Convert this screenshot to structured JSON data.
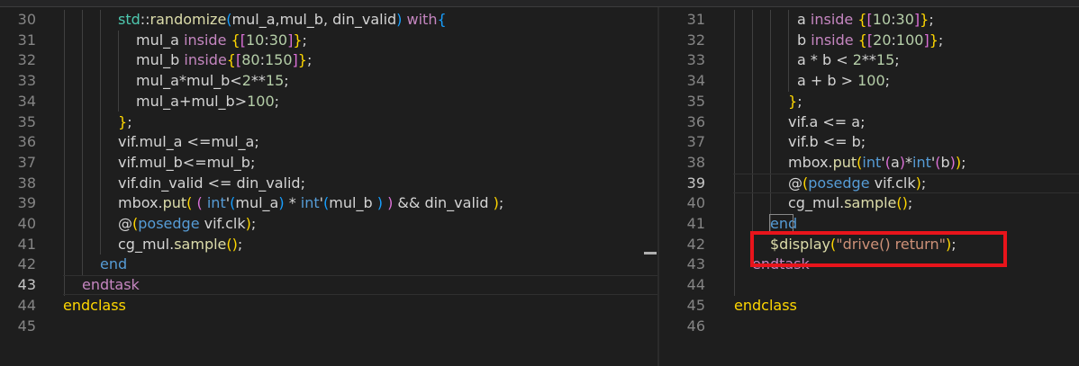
{
  "left_pane": {
    "lines": [
      {
        "n": "30",
        "tokens": [
          [
            "std",
            "ns"
          ],
          [
            "::",
            "var"
          ],
          [
            "randomize",
            "fn"
          ],
          [
            "(",
            "br3"
          ],
          [
            "mul_a,mul_b, din_valid",
            "var"
          ],
          [
            ")",
            "br3"
          ],
          [
            " ",
            "var"
          ],
          [
            "with",
            "ctl"
          ],
          [
            "{",
            "br3"
          ]
        ]
      },
      {
        "n": "31",
        "tokens": [
          [
            "mul_a ",
            "var"
          ],
          [
            "inside",
            "ctl"
          ],
          [
            " ",
            "var"
          ],
          [
            "{",
            "br1"
          ],
          [
            "[",
            "br2"
          ],
          [
            "10",
            "num"
          ],
          [
            ":",
            "var"
          ],
          [
            "30",
            "num"
          ],
          [
            "]",
            "br2"
          ],
          [
            "}",
            "br1"
          ],
          [
            ";",
            "var"
          ]
        ]
      },
      {
        "n": "32",
        "tokens": [
          [
            "mul_b ",
            "var"
          ],
          [
            "inside",
            "ctl"
          ],
          [
            "{",
            "br1"
          ],
          [
            "[",
            "br2"
          ],
          [
            "80",
            "num"
          ],
          [
            ":",
            "var"
          ],
          [
            "150",
            "num"
          ],
          [
            "]",
            "br2"
          ],
          [
            "}",
            "br1"
          ],
          [
            ";",
            "var"
          ]
        ]
      },
      {
        "n": "33",
        "tokens": [
          [
            "mul_a*mul_b<",
            "var"
          ],
          [
            "2",
            "num"
          ],
          [
            "**",
            "var"
          ],
          [
            "15",
            "num"
          ],
          [
            ";",
            "var"
          ]
        ]
      },
      {
        "n": "34",
        "tokens": [
          [
            "mul_a+mul_b>",
            "var"
          ],
          [
            "100",
            "num"
          ],
          [
            ";",
            "var"
          ]
        ]
      },
      {
        "n": "35",
        "tokens": [
          [
            "}",
            "br1"
          ],
          [
            ";",
            "var"
          ]
        ]
      },
      {
        "n": "36",
        "tokens": [
          [
            "vif.mul_a <=mul_a;",
            "var"
          ]
        ]
      },
      {
        "n": "37",
        "tokens": [
          [
            "vif.mul_b<=mul_b;",
            "var"
          ]
        ]
      },
      {
        "n": "38",
        "tokens": [
          [
            "vif.din_valid <= din_valid;",
            "var"
          ]
        ]
      },
      {
        "n": "39",
        "tokens": [
          [
            "mbox.",
            "var"
          ],
          [
            "put",
            "fn"
          ],
          [
            "(",
            "br1"
          ],
          [
            " ",
            "var"
          ],
          [
            "(",
            "br2"
          ],
          [
            " ",
            "var"
          ],
          [
            "int",
            "kw"
          ],
          [
            "'",
            "var"
          ],
          [
            "(",
            "br3"
          ],
          [
            "mul_a",
            "var"
          ],
          [
            ")",
            "br3"
          ],
          [
            " * ",
            "var"
          ],
          [
            "int",
            "kw"
          ],
          [
            "'",
            "var"
          ],
          [
            "(",
            "br3"
          ],
          [
            "mul_b ",
            "var"
          ],
          [
            ")",
            "br3"
          ],
          [
            " ",
            "var"
          ],
          [
            ")",
            "br2"
          ],
          [
            " && din_valid ",
            "var"
          ],
          [
            ")",
            "br1"
          ],
          [
            ";",
            "var"
          ]
        ]
      },
      {
        "n": "40",
        "tokens": [
          [
            "@",
            "var"
          ],
          [
            "(",
            "br1"
          ],
          [
            "posedge",
            "kw"
          ],
          [
            " vif.clk",
            "var"
          ],
          [
            ")",
            "br1"
          ],
          [
            ";",
            "var"
          ]
        ]
      },
      {
        "n": "41",
        "tokens": [
          [
            "cg_mul.",
            "var"
          ],
          [
            "sample",
            "fn"
          ],
          [
            "()",
            "br1"
          ],
          [
            ";",
            "var"
          ]
        ]
      },
      {
        "n": "42",
        "tokens": [
          [
            "end",
            "kw"
          ]
        ]
      },
      {
        "n": "43",
        "tokens": [
          [
            "endtask",
            "ctl"
          ]
        ]
      },
      {
        "n": "44",
        "tokens": [
          [
            "endclass",
            "br1"
          ]
        ]
      },
      {
        "n": "45",
        "tokens": []
      }
    ]
  },
  "right_pane": {
    "lines": [
      {
        "n": "31",
        "tokens": [
          [
            "a ",
            "var"
          ],
          [
            "inside",
            "ctl"
          ],
          [
            " ",
            "var"
          ],
          [
            "{",
            "br1"
          ],
          [
            "[",
            "br2"
          ],
          [
            "10",
            "num"
          ],
          [
            ":",
            "var"
          ],
          [
            "30",
            "num"
          ],
          [
            "]",
            "br2"
          ],
          [
            "}",
            "br1"
          ],
          [
            ";",
            "var"
          ]
        ]
      },
      {
        "n": "32",
        "tokens": [
          [
            "b ",
            "var"
          ],
          [
            "inside",
            "ctl"
          ],
          [
            " ",
            "var"
          ],
          [
            "{",
            "br1"
          ],
          [
            "[",
            "br2"
          ],
          [
            "20",
            "num"
          ],
          [
            ":",
            "var"
          ],
          [
            "100",
            "num"
          ],
          [
            "]",
            "br2"
          ],
          [
            "}",
            "br1"
          ],
          [
            ";",
            "var"
          ]
        ]
      },
      {
        "n": "33",
        "tokens": [
          [
            "a * b < ",
            "var"
          ],
          [
            "2",
            "num"
          ],
          [
            "**",
            "var"
          ],
          [
            "15",
            "num"
          ],
          [
            ";",
            "var"
          ]
        ]
      },
      {
        "n": "34",
        "tokens": [
          [
            "a + b > ",
            "var"
          ],
          [
            "100",
            "num"
          ],
          [
            ";",
            "var"
          ]
        ]
      },
      {
        "n": "35",
        "tokens": [
          [
            "}",
            "br1"
          ],
          [
            ";",
            "var"
          ]
        ]
      },
      {
        "n": "36",
        "tokens": [
          [
            "vif.a <= a;",
            "var"
          ]
        ]
      },
      {
        "n": "37",
        "tokens": [
          [
            "vif.b <= b;",
            "var"
          ]
        ]
      },
      {
        "n": "38",
        "tokens": [
          [
            "mbox.",
            "var"
          ],
          [
            "put",
            "fn"
          ],
          [
            "(",
            "br1"
          ],
          [
            "int",
            "kw"
          ],
          [
            "'",
            "var"
          ],
          [
            "(",
            "br2"
          ],
          [
            "a",
            "var"
          ],
          [
            ")",
            "br2"
          ],
          [
            "*",
            "var"
          ],
          [
            "int",
            "kw"
          ],
          [
            "'",
            "var"
          ],
          [
            "(",
            "br2"
          ],
          [
            "b",
            "var"
          ],
          [
            ")",
            "br2"
          ],
          [
            ")",
            "br1"
          ],
          [
            ";",
            "var"
          ]
        ]
      },
      {
        "n": "39",
        "tokens": [
          [
            "@",
            "var"
          ],
          [
            "(",
            "br1"
          ],
          [
            "posedge",
            "kw"
          ],
          [
            " vif.clk",
            "var"
          ],
          [
            ")",
            "br1"
          ],
          [
            ";",
            "var"
          ]
        ]
      },
      {
        "n": "40",
        "tokens": [
          [
            "cg_mul.",
            "var"
          ],
          [
            "sample",
            "fn"
          ],
          [
            "()",
            "br1"
          ],
          [
            ";",
            "var"
          ]
        ]
      },
      {
        "n": "41",
        "tokens": [
          [
            "end",
            "kw"
          ]
        ]
      },
      {
        "n": "42",
        "tokens": [
          [
            "$display",
            "fn"
          ],
          [
            "(",
            "br1"
          ],
          [
            "\"drive() return\"",
            "str"
          ],
          [
            ")",
            "br1"
          ],
          [
            ";",
            "var"
          ]
        ]
      },
      {
        "n": "43",
        "tokens": [
          [
            "endtask",
            "ctl"
          ]
        ]
      },
      {
        "n": "44",
        "tokens": []
      },
      {
        "n": "45",
        "tokens": [
          [
            "endclass",
            "br1"
          ]
        ]
      },
      {
        "n": "46",
        "tokens": []
      }
    ]
  },
  "colors": {
    "background": "#1e1e1e",
    "highlight_box": "#e8141b",
    "line_number": "#858585"
  }
}
